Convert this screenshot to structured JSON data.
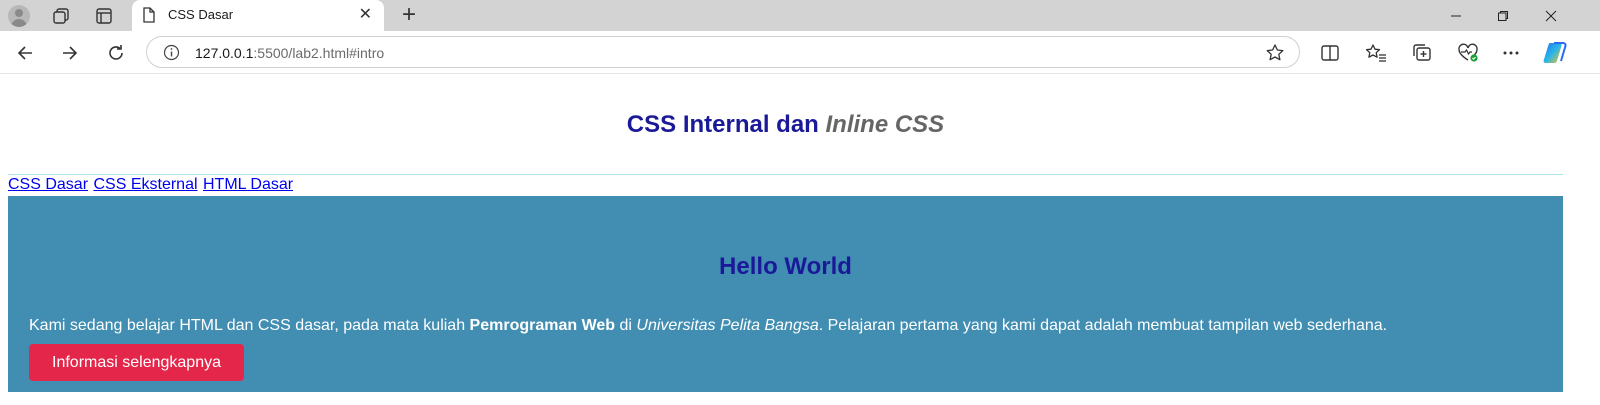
{
  "browser": {
    "tab": {
      "title": "CSS Dasar"
    },
    "url": {
      "host": "127.0.0.1",
      "rest": ":5500/lab2.html#intro"
    },
    "icons": {
      "profile": "avatar-icon",
      "workspaces": "workspaces-icon",
      "tab_actions": "tab-actions-icon",
      "page": "page-icon",
      "close_tab": "close-icon",
      "new_tab": "plus-icon",
      "back": "back-arrow-icon",
      "forward": "forward-arrow-icon",
      "reload": "reload-icon",
      "site_info": "info-icon",
      "favorite": "star-icon",
      "split_screen": "split-screen-icon",
      "favorites": "favorites-icon",
      "collections": "collections-icon",
      "performance": "heart-pulse-icon",
      "more": "more-icon",
      "copilot": "copilot-icon"
    }
  },
  "page": {
    "title_main": "CSS Internal dan ",
    "title_italic": "Inline CSS",
    "nav_links": [
      "CSS Dasar",
      "CSS Eksternal",
      "HTML Dasar"
    ],
    "hero": {
      "title": "Hello World",
      "text_1": "Kami sedang belajar HTML dan CSS dasar, pada mata kuliah ",
      "text_bold": "Pemrograman Web",
      "text_2": " di ",
      "text_italic": "Universitas Pelita Bangsa",
      "text_3": ". Pelajaran pertama yang kami dapat adalah membuat tampilan web sederhana.",
      "button": "Informasi selengkapnya"
    }
  },
  "colors": {
    "heading": "#1a1a99",
    "hero_bg": "#418eb2",
    "button_bg": "#e4264a",
    "link": "#0000ee"
  }
}
